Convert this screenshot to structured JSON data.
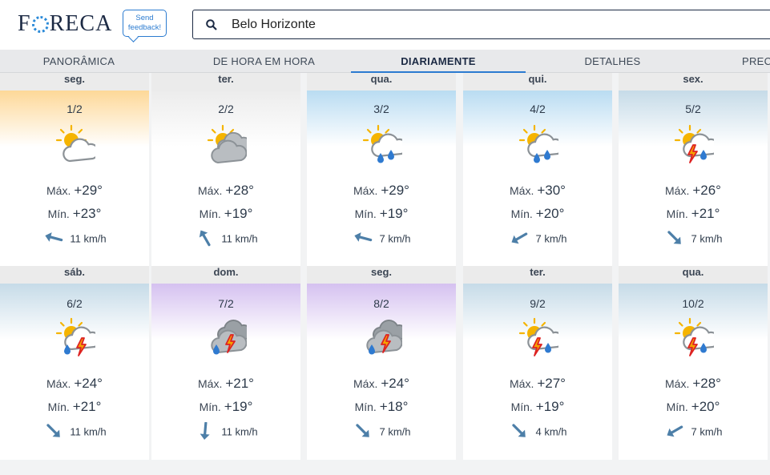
{
  "header": {
    "logo": [
      "F",
      "R",
      "E",
      "C",
      "A"
    ],
    "feedback": "Send feedback!",
    "search_value": "Belo Horizonte"
  },
  "tabs": [
    {
      "label": "PANORÂMICA",
      "active": false
    },
    {
      "label": "DE HORA EM HORA",
      "active": false
    },
    {
      "label": "DIARIAMENTE",
      "active": true
    },
    {
      "label": "DETALHES",
      "active": false
    },
    {
      "label": "PREC",
      "active": false
    }
  ],
  "labels": {
    "max": "Máx.",
    "min": "Mín."
  },
  "days": [
    {
      "day": "seg.",
      "date": "1/2",
      "max": "+29°",
      "min": "+23°",
      "wind": "11 km/h",
      "wind_dir": "from-east",
      "icon": "partly-cloudy-icon",
      "color": "#fdd898"
    },
    {
      "day": "ter.",
      "date": "2/2",
      "max": "+28°",
      "min": "+19°",
      "wind": "11 km/h",
      "wind_dir": "from-southeast",
      "icon": "mostly-cloudy-icon",
      "color": "#ececec"
    },
    {
      "day": "qua.",
      "date": "3/2",
      "max": "+29°",
      "min": "+19°",
      "wind": "7 km/h",
      "wind_dir": "from-east",
      "icon": "showers-icon",
      "color": "#b9dcf2"
    },
    {
      "day": "qui.",
      "date": "4/2",
      "max": "+30°",
      "min": "+20°",
      "wind": "7 km/h",
      "wind_dir": "from-northeast",
      "icon": "showers-icon",
      "color": "#b9dcf2"
    },
    {
      "day": "sex.",
      "date": "5/2",
      "max": "+26°",
      "min": "+21°",
      "wind": "7 km/h",
      "wind_dir": "from-northwest",
      "icon": "thunderstorm-icon",
      "color": "#c6dbe8"
    },
    {
      "day": "sáb.",
      "date": "6/2",
      "max": "+24°",
      "min": "+21°",
      "wind": "11 km/h",
      "wind_dir": "from-northwest",
      "icon": "thunder-showers-icon",
      "color": "#c6dbe8"
    },
    {
      "day": "dom.",
      "date": "7/2",
      "max": "+21°",
      "min": "+19°",
      "wind": "11 km/h",
      "wind_dir": "from-north",
      "icon": "heavy-thunderstorm-icon",
      "color": "#d5c1f0"
    },
    {
      "day": "seg.",
      "date": "8/2",
      "max": "+24°",
      "min": "+18°",
      "wind": "7 km/h",
      "wind_dir": "from-northwest",
      "icon": "heavy-thunderstorm-icon",
      "color": "#d5c1f0"
    },
    {
      "day": "ter.",
      "date": "9/2",
      "max": "+27°",
      "min": "+19°",
      "wind": "4 km/h",
      "wind_dir": "from-northwest",
      "icon": "thunderstorm-icon",
      "color": "#c6dbe8"
    },
    {
      "day": "qua.",
      "date": "10/2",
      "max": "+28°",
      "min": "+20°",
      "wind": "7 km/h",
      "wind_dir": "from-northeast",
      "icon": "thunderstorm-icon",
      "color": "#c6dbe8"
    }
  ]
}
